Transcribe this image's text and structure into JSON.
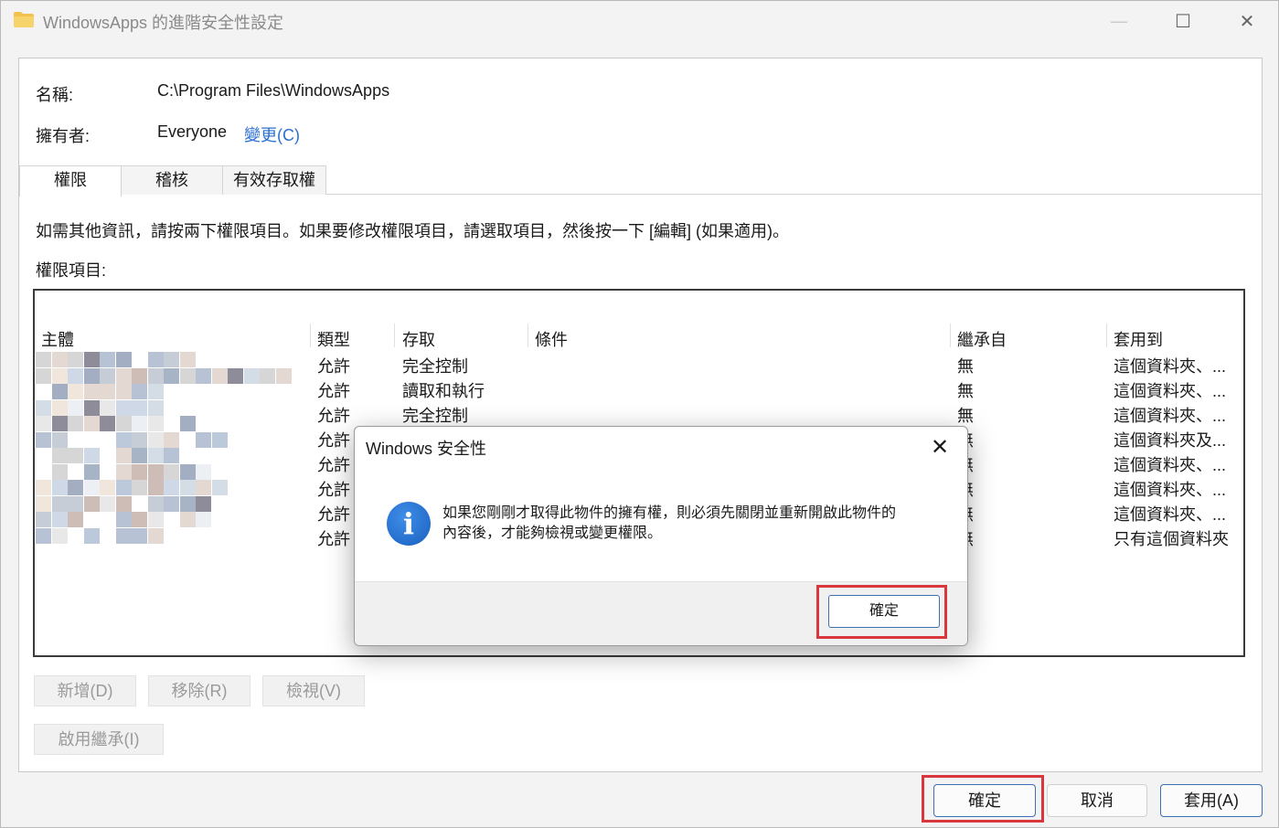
{
  "window": {
    "title": "WindowsApps 的進階安全性設定",
    "minimize_glyph": "—",
    "maximize_glyph": "☐",
    "close_glyph": "✕"
  },
  "info": {
    "name_label": "名稱:",
    "name_value": "C:\\Program Files\\WindowsApps",
    "owner_label": "擁有者:",
    "owner_value": "Everyone",
    "change_link": "變更(C)"
  },
  "tabs": [
    {
      "label": "權限"
    },
    {
      "label": "稽核"
    },
    {
      "label": "有效存取權"
    }
  ],
  "instructions": "如需其他資訊，請按兩下權限項目。如果要修改權限項目，請選取項目，然後按一下 [編輯] (如果適用)。",
  "entries_label": "權限項目:",
  "table": {
    "headers": [
      "主體",
      "類型",
      "存取",
      "條件",
      "繼承自",
      "套用到"
    ],
    "rows": [
      {
        "type": "允許",
        "access": "完全控制",
        "inherited": "無",
        "applies": "這個資料夾、..."
      },
      {
        "type": "允許",
        "access": "讀取和執行",
        "inherited": "無",
        "applies": "這個資料夾、..."
      },
      {
        "type": "允許",
        "access": "完全控制",
        "inherited": "無",
        "applies": "這個資料夾、..."
      },
      {
        "type": "允許",
        "access": "",
        "inherited": "無",
        "applies": "這個資料夾及..."
      },
      {
        "type": "允許",
        "access": "",
        "inherited": "無",
        "applies": "這個資料夾、..."
      },
      {
        "type": "允許",
        "access": "",
        "inherited": "無",
        "applies": "這個資料夾、..."
      },
      {
        "type": "允許",
        "access": "",
        "inherited": "無",
        "applies": "這個資料夾、..."
      },
      {
        "type": "允許",
        "access": "",
        "inherited": "無",
        "applies": "只有這個資料夾"
      }
    ]
  },
  "actions": {
    "add": "新增(D)",
    "remove": "移除(R)",
    "view": "檢視(V)",
    "enable_inheritance": "啟用繼承(I)"
  },
  "footer": {
    "ok": "確定",
    "cancel": "取消",
    "apply": "套用(A)"
  },
  "dialog": {
    "title": "Windows 安全性",
    "close_glyph": "✕",
    "icon_glyph": "i",
    "message_line1": "如果您剛剛才取得此物件的擁有權，則必須先關閉並重新開啟此物件的",
    "message_line2": "內容後，才能夠檢視或變更權限。",
    "ok": "確定"
  },
  "colors": {
    "link": "#2a6fd1",
    "highlight": "#d9363e",
    "info_icon": "#1b5fbf"
  }
}
